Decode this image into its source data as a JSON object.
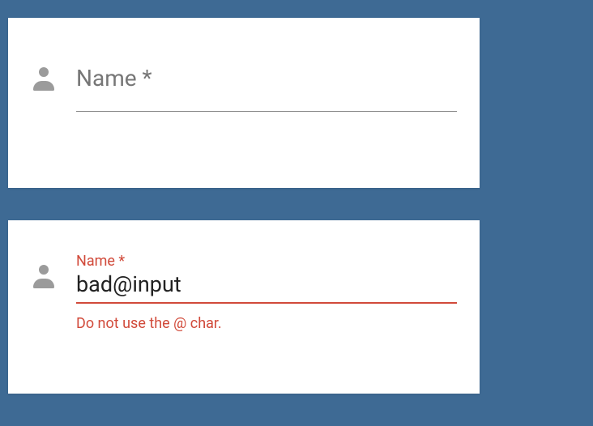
{
  "colors": {
    "background": "#3e6a94",
    "error": "#d14a3a",
    "text_muted": "#777",
    "icon": "#9b9b9b"
  },
  "field_empty": {
    "label": "Name *"
  },
  "field_invalid": {
    "label": "Name *",
    "value": "bad@input",
    "helper": "Do not use the @ char."
  }
}
